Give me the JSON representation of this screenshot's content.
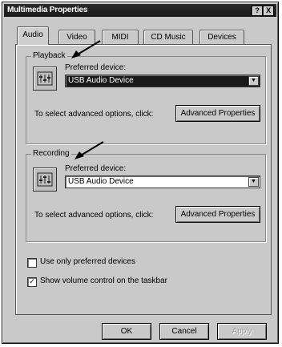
{
  "window": {
    "title": "Multimedia Properties",
    "help_btn": "?",
    "close_btn": "X"
  },
  "tabs": [
    {
      "label": "Audio",
      "active": true
    },
    {
      "label": "Video",
      "active": false
    },
    {
      "label": "MIDI",
      "active": false
    },
    {
      "label": "CD Music",
      "active": false
    },
    {
      "label": "Devices",
      "active": false
    }
  ],
  "playback": {
    "group_label": "Playback",
    "device_label": "Preferred device:",
    "device_value": "USB Audio Device",
    "advanced_text": "To select advanced options, click:",
    "advanced_button": "Advanced Properties"
  },
  "recording": {
    "group_label": "Recording",
    "device_label": "Preferred device:",
    "device_value": "USB Audio Device",
    "advanced_text": "To select advanced options, click:",
    "advanced_button": "Advanced Properties"
  },
  "options": {
    "use_preferred_only": {
      "label": "Use only preferred devices",
      "checked": false
    },
    "show_volume": {
      "label": "Show volume control on the taskbar",
      "checked": true,
      "mark": "✓"
    }
  },
  "footer": {
    "ok": "OK",
    "cancel": "Cancel",
    "apply": "Apply"
  },
  "colors": {
    "face": "#c9c9c9",
    "titlebar": "#1a1a1a",
    "selection": "#1a1a1a",
    "arrow": "#000000"
  }
}
